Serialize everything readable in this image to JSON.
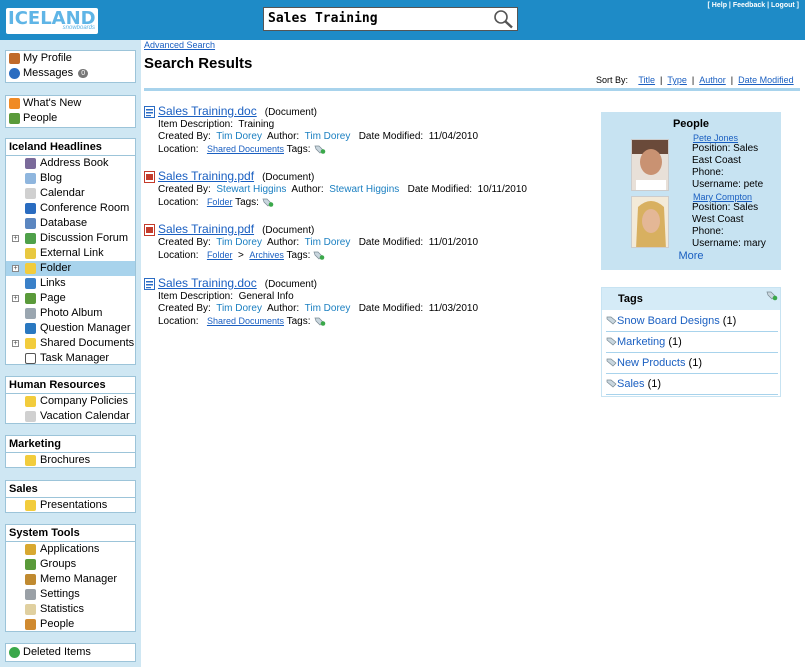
{
  "header": {
    "logo_main": "ICELAND",
    "logo_sub": "snowboards",
    "search_value": "Sales Training",
    "links": [
      "[ Help",
      "Feedback",
      "Logout ]"
    ]
  },
  "sidebar": {
    "profile": [
      {
        "label": "My Profile",
        "icon": "profile-icon"
      },
      {
        "label": "Messages",
        "icon": "messages-icon",
        "badge": "0"
      }
    ],
    "general": [
      {
        "label": "What's New",
        "icon": "rss-icon"
      },
      {
        "label": "People",
        "icon": "people-icon"
      }
    ],
    "iceland": {
      "title": "Iceland Headlines",
      "items": [
        {
          "label": "Address Book",
          "icon": "address-book-icon"
        },
        {
          "label": "Blog",
          "icon": "blog-icon"
        },
        {
          "label": "Calendar",
          "icon": "calendar-icon"
        },
        {
          "label": "Conference Room",
          "icon": "conference-room-icon"
        },
        {
          "label": "Database",
          "icon": "database-icon"
        },
        {
          "label": "Discussion Forum",
          "icon": "forum-icon",
          "expandable": true
        },
        {
          "label": "External Link",
          "icon": "external-link-icon"
        },
        {
          "label": "Folder",
          "icon": "folder-icon",
          "expandable": true,
          "selected": true
        },
        {
          "label": "Links",
          "icon": "links-icon"
        },
        {
          "label": "Page",
          "icon": "page-icon",
          "expandable": true
        },
        {
          "label": "Photo Album",
          "icon": "photo-album-icon"
        },
        {
          "label": "Question Manager",
          "icon": "question-icon"
        },
        {
          "label": "Shared Documents",
          "icon": "folder-icon",
          "expandable": true
        },
        {
          "label": "Task Manager",
          "icon": "task-icon"
        }
      ]
    },
    "hr": {
      "title": "Human Resources",
      "items": [
        {
          "label": "Company Policies",
          "icon": "folder-icon"
        },
        {
          "label": "Vacation Calendar",
          "icon": "calendar-icon"
        }
      ]
    },
    "marketing": {
      "title": "Marketing",
      "items": [
        {
          "label": "Brochures",
          "icon": "folder-icon"
        }
      ]
    },
    "sales": {
      "title": "Sales",
      "items": [
        {
          "label": "Presentations",
          "icon": "folder-icon"
        }
      ]
    },
    "system": {
      "title": "System Tools",
      "items": [
        {
          "label": "Applications",
          "icon": "key-icon"
        },
        {
          "label": "Groups",
          "icon": "groups-icon"
        },
        {
          "label": "Memo Manager",
          "icon": "pencil-icon"
        },
        {
          "label": "Settings",
          "icon": "gear-icon"
        },
        {
          "label": "Statistics",
          "icon": "statistics-icon"
        },
        {
          "label": "People",
          "icon": "people-icon"
        }
      ]
    },
    "deleted": {
      "label": "Deleted Items",
      "icon": "recycle-icon"
    }
  },
  "main": {
    "advanced_search": "Advanced Search",
    "title": "Search Results",
    "sort": {
      "label": "Sort By:",
      "options": [
        "Title",
        "Type",
        "Author",
        "Date Modified"
      ]
    },
    "labels": {
      "item_description": "Item Description:",
      "created_by": "Created By:",
      "author": "Author:",
      "date_modified": "Date Modified:",
      "location": "Location:",
      "tags": "Tags:",
      "arrow": ">"
    },
    "results": [
      {
        "title": "Sales Training.doc",
        "type": "(Document)",
        "description": "Training",
        "created_by": "Tim Dorey",
        "author": "Tim Dorey",
        "date": "11/04/2010",
        "location": [
          "Shared Documents"
        ],
        "icon_color": "#2b6cc4"
      },
      {
        "title": "Sales Training.pdf",
        "type": "(Document)",
        "description": "",
        "created_by": "Stewart Higgins",
        "author": "Stewart Higgins",
        "date": "10/11/2010",
        "location": [
          "Folder"
        ],
        "icon_color": "#c43b2b"
      },
      {
        "title": "Sales Training.pdf",
        "type": "(Document)",
        "description": "",
        "created_by": "Tim Dorey",
        "author": "Tim Dorey",
        "date": "11/01/2010",
        "location": [
          "Folder",
          "Archives"
        ],
        "icon_color": "#c43b2b"
      },
      {
        "title": "Sales Training.doc",
        "type": "(Document)",
        "description": "General Info",
        "created_by": "Tim Dorey",
        "author": "Tim Dorey",
        "date": "11/03/2010",
        "location": [
          "Shared Documents"
        ],
        "icon_color": "#2b6cc4"
      }
    ]
  },
  "people_panel": {
    "title": "People",
    "people": [
      {
        "name": "Pete Jones",
        "position": "Position:  Sales",
        "region": "East Coast",
        "phone": "Phone:",
        "username": "Username:  pete"
      },
      {
        "name": "Mary Compton",
        "position": "Position:  Sales",
        "region": "West Coast",
        "phone": "Phone:",
        "username": "Username:  mary"
      }
    ],
    "more": "More"
  },
  "tags_panel": {
    "title": "Tags",
    "tags": [
      {
        "name": "Snow Board Designs",
        "count": "(1)"
      },
      {
        "name": "Marketing",
        "count": "(1)"
      },
      {
        "name": "New Products",
        "count": "(1)"
      },
      {
        "name": "Sales",
        "count": "(1)"
      }
    ]
  },
  "colors": {
    "header_bg": "#1e8bc7",
    "sidebar_bg": "#cfe7f3",
    "link": "#1a5fc1",
    "person_link": "#1a7fc1"
  }
}
